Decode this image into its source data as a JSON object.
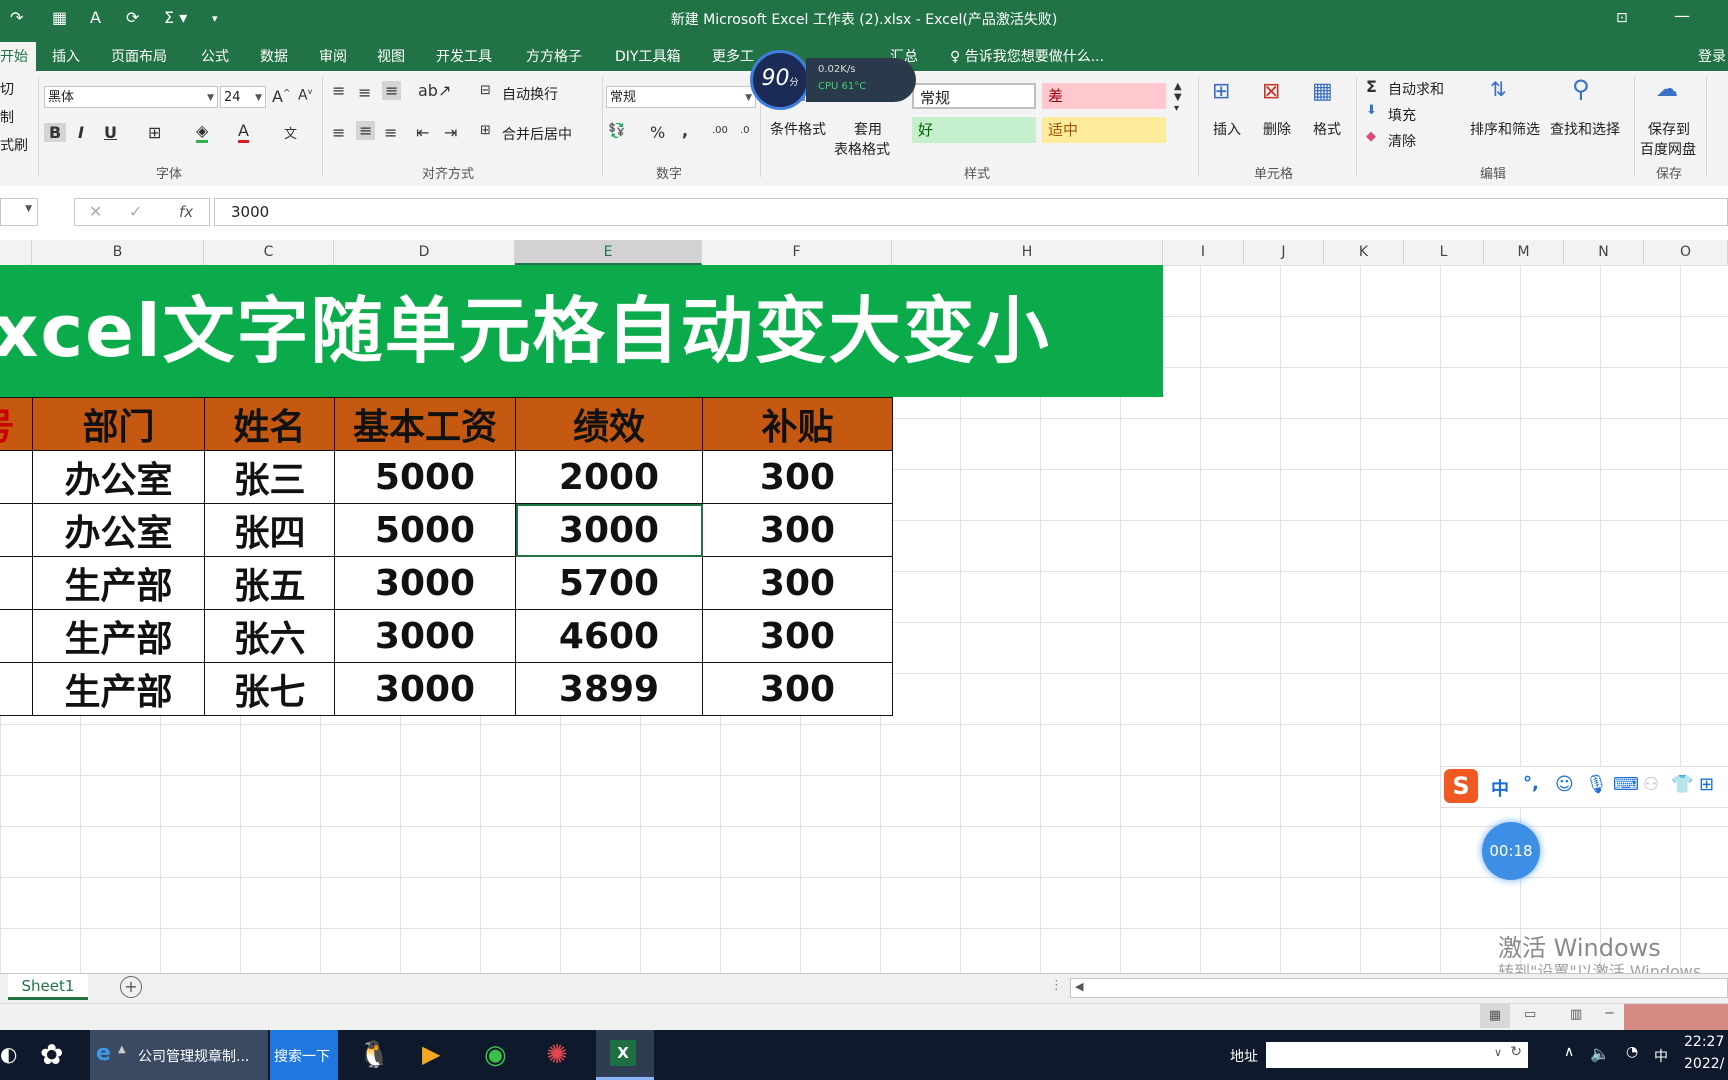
{
  "window": {
    "title": "新建 Microsoft Excel 工作表 (2).xlsx - Excel(产品激活失败)"
  },
  "tabs": [
    "开始",
    "插入",
    "页面布局",
    "公式",
    "数据",
    "审阅",
    "视图",
    "开发工具",
    "方方格子",
    "DIY工具箱",
    "更多工",
    "汇总"
  ],
  "tell_me": "告诉我您想要做什么...",
  "login": "登录",
  "ribbon": {
    "clipboard": {
      "cut": "切",
      "copy": "制",
      "format_painter": "式刷"
    },
    "font": {
      "name": "黑体",
      "size": "24",
      "group": "字体",
      "bold": "B",
      "italic": "I",
      "underline": "U"
    },
    "alignment": {
      "wrap": "自动换行",
      "merge": "合并后居中",
      "group": "对齐方式"
    },
    "number": {
      "format": "常规",
      "group": "数字",
      "percent": "%",
      "comma": ","
    },
    "styles": {
      "conditional": "条件格式",
      "table_format_1": "套用",
      "table_format_2": "表格格式",
      "normal": "常规",
      "bad": "差",
      "good": "好",
      "neutral": "适中",
      "group": "样式"
    },
    "cells": {
      "insert": "插入",
      "delete": "删除",
      "format": "格式",
      "group": "单元格"
    },
    "editing": {
      "autosum": "自动求和",
      "fill": "填充",
      "clear": "清除",
      "sort": "排序和筛选",
      "find": "查找和选择",
      "group": "编辑"
    },
    "save": {
      "label1": "保存到",
      "label2": "百度网盘",
      "group": "保存"
    }
  },
  "formula_bar": {
    "value": "3000",
    "fx": "fx"
  },
  "columns": [
    "B",
    "C",
    "D",
    "E",
    "F",
    "H",
    "I",
    "J",
    "K",
    "L",
    "M",
    "N",
    "O"
  ],
  "selected_column": "E",
  "banner": "xcel文字随单元格自动变大变小",
  "table": {
    "headers": [
      "号",
      "部门",
      "姓名",
      "基本工资",
      "绩效",
      "补贴"
    ],
    "rows": [
      [
        "",
        "办公室",
        "张三",
        "5000",
        "2000",
        "300"
      ],
      [
        "",
        "办公室",
        "张四",
        "5000",
        "3000",
        "300"
      ],
      [
        "",
        "生产部",
        "张五",
        "3000",
        "5700",
        "300"
      ],
      [
        "",
        "生产部",
        "张六",
        "3000",
        "4600",
        "300"
      ],
      [
        "",
        "生产部",
        "张七",
        "3000",
        "3899",
        "300"
      ]
    ],
    "selected_cell": {
      "row": 1,
      "col": 4
    }
  },
  "sheet_tab": "Sheet1",
  "perf_widget": {
    "score": "90",
    "unit": "分",
    "net": "0.02K/s",
    "cpu": "CPU 61°C"
  },
  "ime": {
    "mode": "中",
    "punct": "°,"
  },
  "timer": "00:18",
  "activation": {
    "line1": "激活 Windows",
    "line2": "转到\"设置\"以激活 Windows。"
  },
  "taskbar": {
    "browser_item": "公司管理规章制...",
    "search_button": "搜索一下",
    "address_label": "地址",
    "time": "22:27",
    "date": "2022/",
    "input_lang": "中"
  }
}
